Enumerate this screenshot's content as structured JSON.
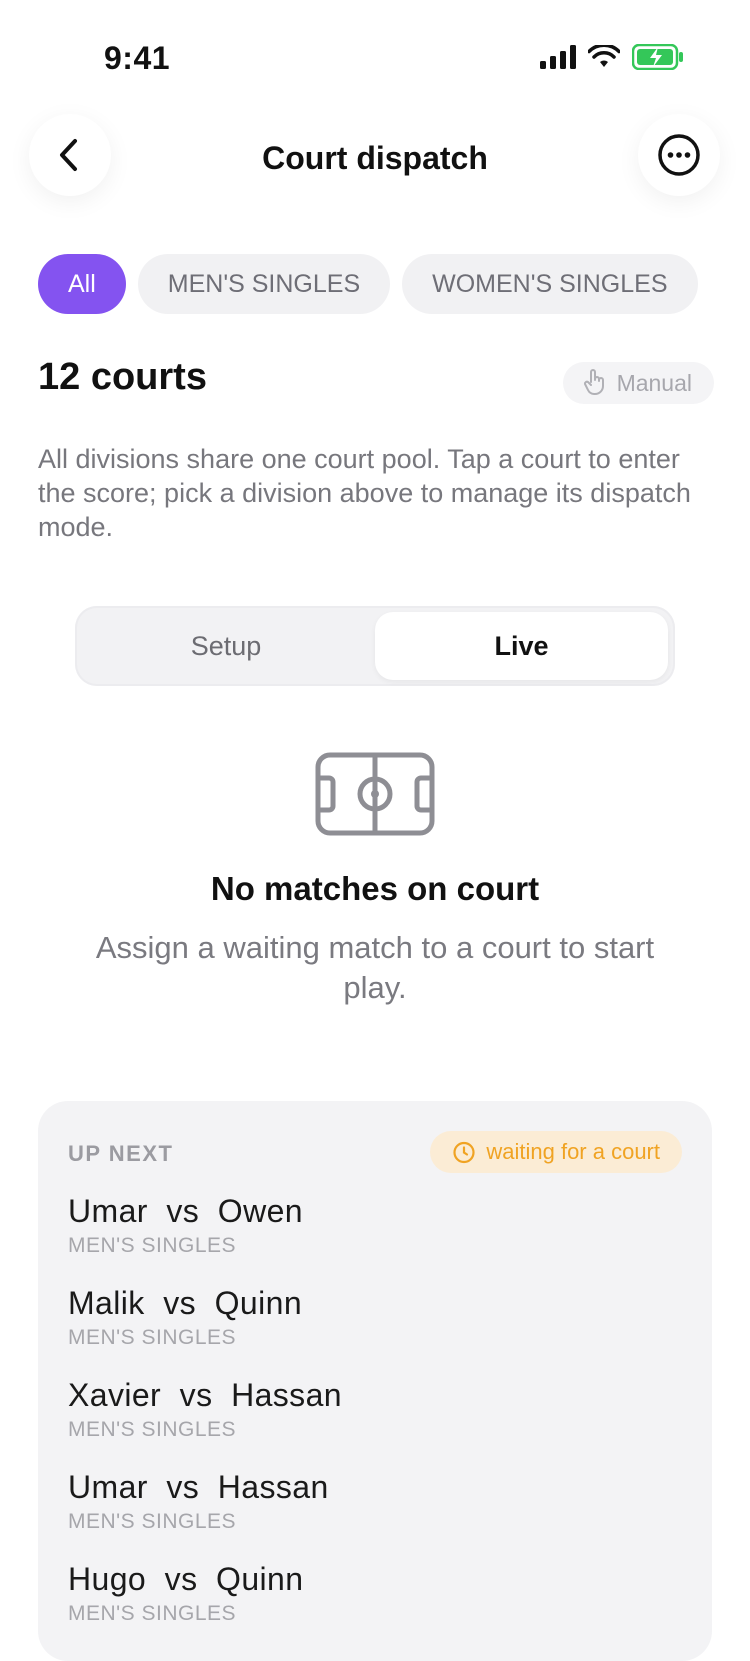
{
  "status_bar": {
    "time": "9:41"
  },
  "header": {
    "title": "Court dispatch"
  },
  "filters": [
    {
      "label": "All",
      "active": true
    },
    {
      "label": "MEN'S SINGLES",
      "active": false
    },
    {
      "label": "WOMEN'S SINGLES",
      "active": false
    }
  ],
  "courts": {
    "title": "12 courts",
    "mode": "Manual",
    "description": "All divisions share one court pool. Tap a court to enter the score; pick a division above to manage its dispatch mode."
  },
  "segmented": {
    "setup": "Setup",
    "live": "Live",
    "selected": "Live"
  },
  "empty_state": {
    "title": "No matches on court",
    "subtitle": "Assign a waiting match to a court to start play."
  },
  "up_next": {
    "label": "UP NEXT",
    "badge": "waiting for a court",
    "matches": [
      {
        "name": "Umar  vs  Owen",
        "division": "MEN'S SINGLES"
      },
      {
        "name": "Malik  vs  Quinn",
        "division": "MEN'S SINGLES"
      },
      {
        "name": "Xavier  vs  Hassan",
        "division": "MEN'S SINGLES"
      },
      {
        "name": "Umar  vs  Hassan",
        "division": "MEN'S SINGLES"
      },
      {
        "name": "Hugo  vs  Quinn",
        "division": "MEN'S SINGLES"
      }
    ]
  },
  "colors": {
    "accent": "#8453f0",
    "warning": "#f0a323",
    "battery": "#34c759"
  }
}
